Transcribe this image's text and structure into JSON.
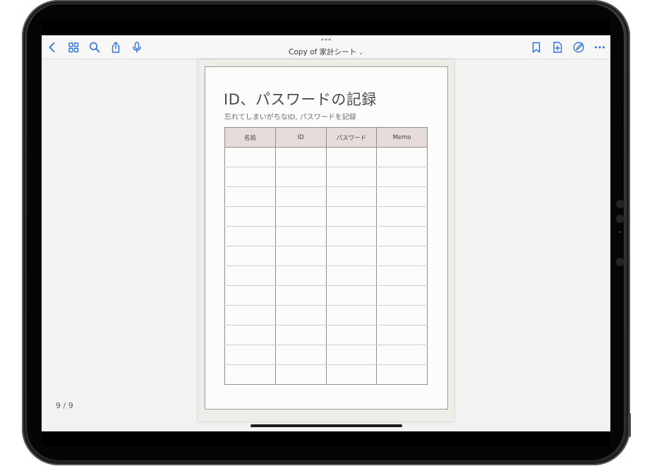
{
  "toolbar": {
    "icons": [
      "back-chevron-icon",
      "grid-icon",
      "search-icon",
      "share-icon",
      "microphone-icon",
      "bookmark-icon",
      "add-page-icon",
      "markup-pen-icon",
      "more-icon"
    ],
    "title_label": "Copy of 家計シート",
    "title_chevron": "⌄"
  },
  "page_counter": "9 / 9",
  "document": {
    "title": "ID、パスワードの記録",
    "subtitle": "忘れてしまいがちなID, パスワードを記録",
    "table": {
      "headers": [
        "名前",
        "ID",
        "パスワード",
        "Memo"
      ],
      "empty_rows": 12
    }
  },
  "colors": {
    "accent": "#2f6fe4",
    "header_fill": "#e6dcdc",
    "toolbar_bg": "#f7f7f8",
    "canvas_bg": "#f2f2f3"
  }
}
